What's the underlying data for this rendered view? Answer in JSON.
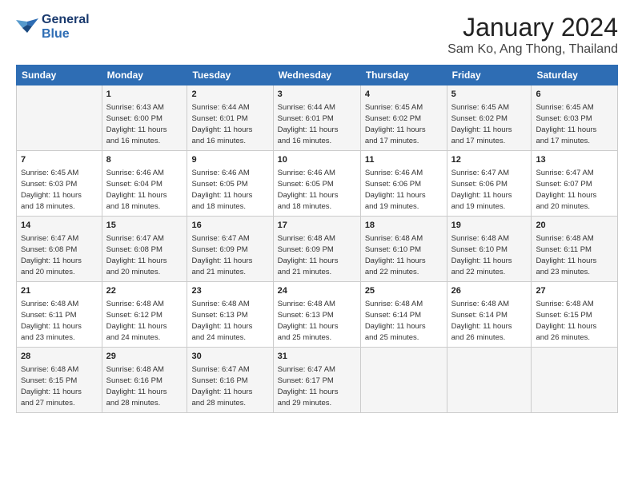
{
  "header": {
    "logo_line1": "General",
    "logo_line2": "Blue",
    "month": "January 2024",
    "location": "Sam Ko, Ang Thong, Thailand"
  },
  "weekdays": [
    "Sunday",
    "Monday",
    "Tuesday",
    "Wednesday",
    "Thursday",
    "Friday",
    "Saturday"
  ],
  "weeks": [
    [
      {
        "day": "",
        "info": ""
      },
      {
        "day": "1",
        "info": "Sunrise: 6:43 AM\nSunset: 6:00 PM\nDaylight: 11 hours\nand 16 minutes."
      },
      {
        "day": "2",
        "info": "Sunrise: 6:44 AM\nSunset: 6:01 PM\nDaylight: 11 hours\nand 16 minutes."
      },
      {
        "day": "3",
        "info": "Sunrise: 6:44 AM\nSunset: 6:01 PM\nDaylight: 11 hours\nand 16 minutes."
      },
      {
        "day": "4",
        "info": "Sunrise: 6:45 AM\nSunset: 6:02 PM\nDaylight: 11 hours\nand 17 minutes."
      },
      {
        "day": "5",
        "info": "Sunrise: 6:45 AM\nSunset: 6:02 PM\nDaylight: 11 hours\nand 17 minutes."
      },
      {
        "day": "6",
        "info": "Sunrise: 6:45 AM\nSunset: 6:03 PM\nDaylight: 11 hours\nand 17 minutes."
      }
    ],
    [
      {
        "day": "7",
        "info": "Sunrise: 6:45 AM\nSunset: 6:03 PM\nDaylight: 11 hours\nand 18 minutes."
      },
      {
        "day": "8",
        "info": "Sunrise: 6:46 AM\nSunset: 6:04 PM\nDaylight: 11 hours\nand 18 minutes."
      },
      {
        "day": "9",
        "info": "Sunrise: 6:46 AM\nSunset: 6:05 PM\nDaylight: 11 hours\nand 18 minutes."
      },
      {
        "day": "10",
        "info": "Sunrise: 6:46 AM\nSunset: 6:05 PM\nDaylight: 11 hours\nand 18 minutes."
      },
      {
        "day": "11",
        "info": "Sunrise: 6:46 AM\nSunset: 6:06 PM\nDaylight: 11 hours\nand 19 minutes."
      },
      {
        "day": "12",
        "info": "Sunrise: 6:47 AM\nSunset: 6:06 PM\nDaylight: 11 hours\nand 19 minutes."
      },
      {
        "day": "13",
        "info": "Sunrise: 6:47 AM\nSunset: 6:07 PM\nDaylight: 11 hours\nand 20 minutes."
      }
    ],
    [
      {
        "day": "14",
        "info": "Sunrise: 6:47 AM\nSunset: 6:08 PM\nDaylight: 11 hours\nand 20 minutes."
      },
      {
        "day": "15",
        "info": "Sunrise: 6:47 AM\nSunset: 6:08 PM\nDaylight: 11 hours\nand 20 minutes."
      },
      {
        "day": "16",
        "info": "Sunrise: 6:47 AM\nSunset: 6:09 PM\nDaylight: 11 hours\nand 21 minutes."
      },
      {
        "day": "17",
        "info": "Sunrise: 6:48 AM\nSunset: 6:09 PM\nDaylight: 11 hours\nand 21 minutes."
      },
      {
        "day": "18",
        "info": "Sunrise: 6:48 AM\nSunset: 6:10 PM\nDaylight: 11 hours\nand 22 minutes."
      },
      {
        "day": "19",
        "info": "Sunrise: 6:48 AM\nSunset: 6:10 PM\nDaylight: 11 hours\nand 22 minutes."
      },
      {
        "day": "20",
        "info": "Sunrise: 6:48 AM\nSunset: 6:11 PM\nDaylight: 11 hours\nand 23 minutes."
      }
    ],
    [
      {
        "day": "21",
        "info": "Sunrise: 6:48 AM\nSunset: 6:11 PM\nDaylight: 11 hours\nand 23 minutes."
      },
      {
        "day": "22",
        "info": "Sunrise: 6:48 AM\nSunset: 6:12 PM\nDaylight: 11 hours\nand 24 minutes."
      },
      {
        "day": "23",
        "info": "Sunrise: 6:48 AM\nSunset: 6:13 PM\nDaylight: 11 hours\nand 24 minutes."
      },
      {
        "day": "24",
        "info": "Sunrise: 6:48 AM\nSunset: 6:13 PM\nDaylight: 11 hours\nand 25 minutes."
      },
      {
        "day": "25",
        "info": "Sunrise: 6:48 AM\nSunset: 6:14 PM\nDaylight: 11 hours\nand 25 minutes."
      },
      {
        "day": "26",
        "info": "Sunrise: 6:48 AM\nSunset: 6:14 PM\nDaylight: 11 hours\nand 26 minutes."
      },
      {
        "day": "27",
        "info": "Sunrise: 6:48 AM\nSunset: 6:15 PM\nDaylight: 11 hours\nand 26 minutes."
      }
    ],
    [
      {
        "day": "28",
        "info": "Sunrise: 6:48 AM\nSunset: 6:15 PM\nDaylight: 11 hours\nand 27 minutes."
      },
      {
        "day": "29",
        "info": "Sunrise: 6:48 AM\nSunset: 6:16 PM\nDaylight: 11 hours\nand 28 minutes."
      },
      {
        "day": "30",
        "info": "Sunrise: 6:47 AM\nSunset: 6:16 PM\nDaylight: 11 hours\nand 28 minutes."
      },
      {
        "day": "31",
        "info": "Sunrise: 6:47 AM\nSunset: 6:17 PM\nDaylight: 11 hours\nand 29 minutes."
      },
      {
        "day": "",
        "info": ""
      },
      {
        "day": "",
        "info": ""
      },
      {
        "day": "",
        "info": ""
      }
    ]
  ]
}
